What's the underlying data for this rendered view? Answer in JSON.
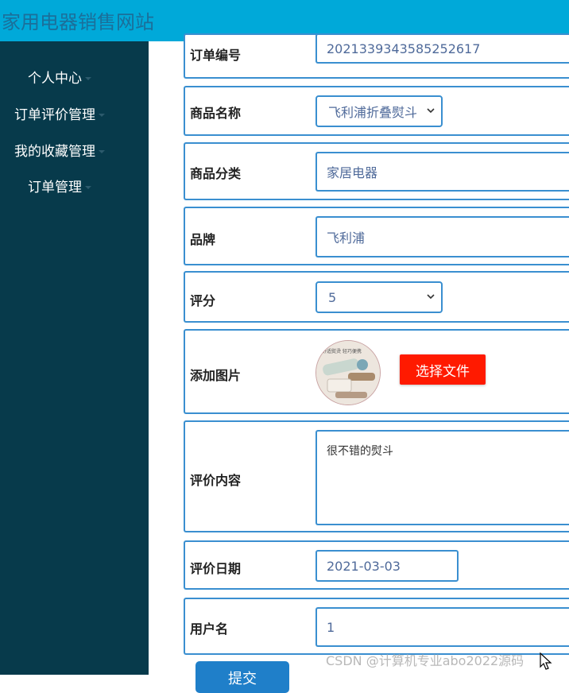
{
  "header": {
    "title": "家用电器销售网站"
  },
  "sidebar": {
    "items": [
      {
        "label": "个人中心"
      },
      {
        "label": "订单评价管理"
      },
      {
        "label": "我的收藏管理"
      },
      {
        "label": "订单管理"
      }
    ]
  },
  "form": {
    "order_no": {
      "label": "订单编号",
      "value": "2021339343585252617"
    },
    "product_name": {
      "label": "商品名称",
      "value": "飞利浦折叠熨斗"
    },
    "category": {
      "label": "商品分类",
      "value": "家居电器"
    },
    "brand": {
      "label": "品牌",
      "value": "飞利浦"
    },
    "rating": {
      "label": "评分",
      "value": "5"
    },
    "image": {
      "label": "添加图片",
      "button_label": "选择文件",
      "thumb_caption": "舒适熨烫 轻巧便携"
    },
    "content": {
      "label": "评价内容",
      "value": "很不错的熨斗"
    },
    "date": {
      "label": "评价日期",
      "value": "2021-03-03"
    },
    "username": {
      "label": "用户名",
      "value": "1"
    },
    "submit_label": "提交"
  },
  "watermark": "CSDN @计算机专业abo2022源码",
  "colors": {
    "header_bg": "#00a9d9",
    "sidebar_bg": "#073a4b",
    "field_border": "#3a8fd0",
    "file_button": "#ff1a00",
    "submit_button": "#1f7fc9"
  }
}
